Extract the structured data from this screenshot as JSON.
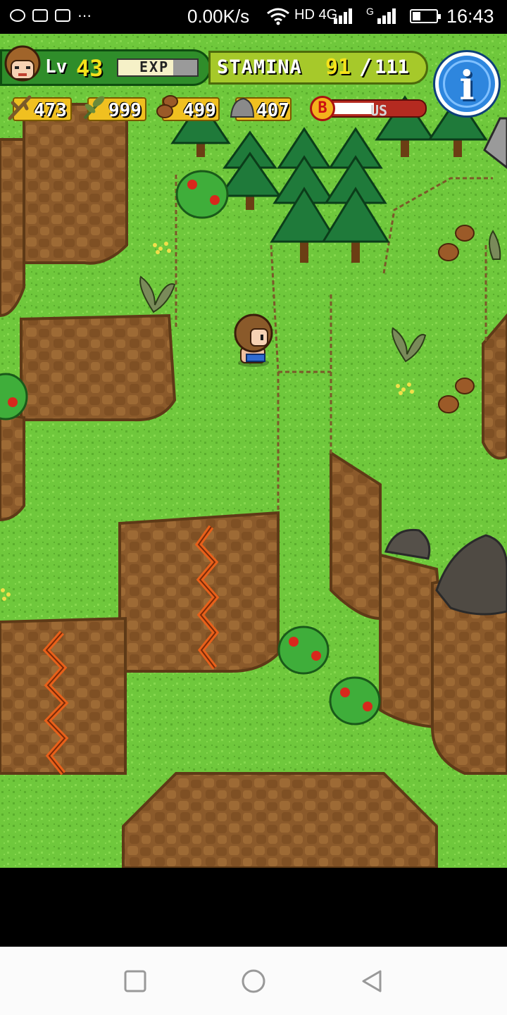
{
  "status_bar": {
    "network_speed": "0.00K/s",
    "network_type_1": "HD 4G",
    "network_type_2": "G",
    "battery_level": 0.35,
    "time": "16:43",
    "notification_icons": [
      "game-controller-icon",
      "calendar-icon",
      "tv-icon",
      "more-dots-icon"
    ]
  },
  "hud": {
    "level_label": "Lv",
    "level": "43",
    "exp_label": "EXP",
    "exp_progress": 0.7,
    "stamina_label": "STAMINA",
    "stamina_current": "91",
    "stamina_separator": "/",
    "stamina_max": "111",
    "info_button_glyph": "i",
    "bonus_badge_letter": "B",
    "bonus_label": "US",
    "bonus_progress": 0.48,
    "resources": [
      {
        "name": "branches",
        "icon": "branch-icon",
        "value": "473"
      },
      {
        "name": "herbs",
        "icon": "herb-icon",
        "value": "999"
      },
      {
        "name": "nuts",
        "icon": "nut-icon",
        "value": "499"
      },
      {
        "name": "stones",
        "icon": "stone-icon",
        "value": "407"
      }
    ]
  },
  "colors": {
    "grass": "#6fc83c",
    "grass_dark": "#5aae2d",
    "cliff": "#8b5a2b",
    "cliff_dark": "#5e3a17",
    "lava_crack": "#e8601a",
    "tree": "#1f7a3a",
    "hud_green": "#2f8d2a",
    "hud_lime": "#a6c92a",
    "hud_yellow": "#f5e21a",
    "info_blue": "#2e86de"
  },
  "navigation_bar": {
    "buttons": [
      "recent-apps-icon",
      "home-icon",
      "back-icon"
    ]
  }
}
